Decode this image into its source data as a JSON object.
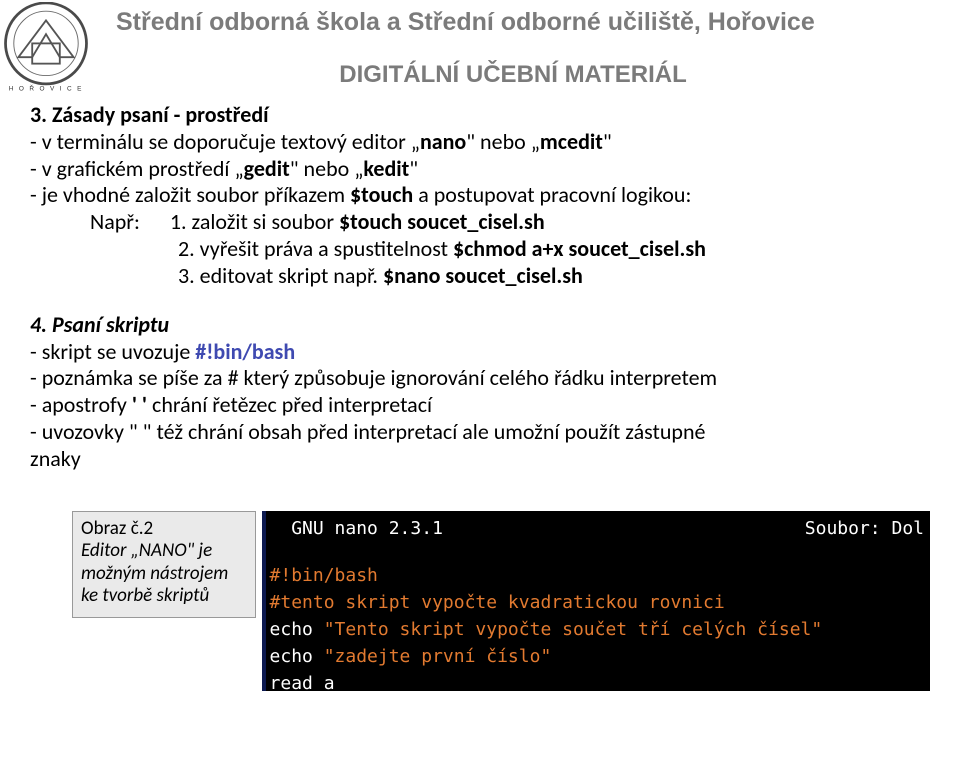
{
  "header": {
    "school_name": "Střední odborná škola a Střední odborné učiliště, Hořovice",
    "subtitle": "DIGITÁLNÍ UČEBNÍ MATERIÁL",
    "logo_alt": "school-emblem"
  },
  "sec3": {
    "heading": "3. Zásady psaní - prostředí",
    "l1a": "- v terminálu se doporučuje textový editor „",
    "l1nano": "nano",
    "l1mid": "\" nebo „",
    "l1mcedit": "mcedit",
    "l1end": "\"",
    "l2a": "- v grafickém prostředí „",
    "l2gedit": "gedit",
    "l2mid": "\" nebo „",
    "l2kedit": "kedit",
    "l2end": "\"",
    "l3a": "- je vhodné založit soubor příkazem ",
    "l3touch": "$touch",
    "l3b": " a postupovat pracovní logikou:",
    "napr": "Např:",
    "n1a": "1. založit si soubor ",
    "n1b": "$touch soucet_cisel.sh",
    "n2a": "2. vyřešit práva a spustitelnost ",
    "n2b": "$chmod a+x soucet_cisel.sh",
    "n3a": "3. editovat skript např.   ",
    "n3b": "$nano  soucet_cisel.sh"
  },
  "sec4": {
    "heading": "4. Psaní skriptu",
    "l1a": "- skript se uvozuje     ",
    "l1b": "#!bin/bash",
    "l2": "- poznámka se píše za # který způsobuje ignorování celého řádku interpretem",
    "l3a": "- apostrofy ",
    "l3q": "'  '",
    "l3b": " chrání řetězec před interpretací",
    "l4": "- uvozovky \"  \" též chrání obsah před interpretací ale    umožní použít zástupné",
    "l5": "znaky"
  },
  "caption": {
    "line1": "Obraz č.2",
    "line2": "Editor „NANO\" je možným nástrojem ke tvorbě skriptů"
  },
  "terminal": {
    "title_left": "  GNU nano 2.3.1",
    "title_right": "Soubor: Dol",
    "line1": "#!bin/bash",
    "line2": "#tento skript vypočte kvadratickou rovnici",
    "line3": "",
    "line4_a": "echo ",
    "line4_b": "\"Tento skript vypočte součet tří celých čísel\"",
    "line5_a": "echo ",
    "line5_b": "\"zadejte první číslo\"",
    "line6": "read a"
  }
}
